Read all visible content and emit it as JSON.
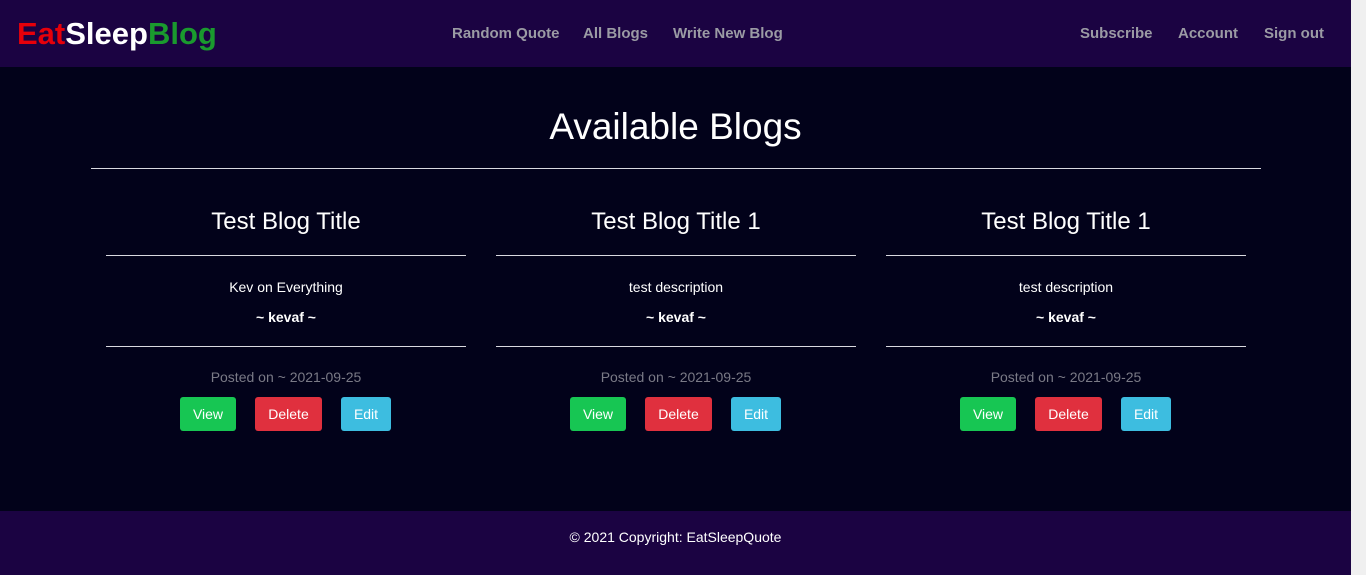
{
  "brand": {
    "part1": "Eat",
    "part2": "Sleep",
    "part3": "Blog"
  },
  "nav": {
    "left": [
      "Random Quote",
      "All Blogs",
      "Write New Blog"
    ],
    "right": [
      "Subscribe",
      "Account",
      "Sign out"
    ]
  },
  "main": {
    "title": "Available Blogs",
    "cards": [
      {
        "title": "Test Blog Title",
        "description": "Kev on Everything",
        "author": "~ kevaf ~",
        "date": "Posted on ~ 2021-09-25",
        "view_label": "View",
        "delete_label": "Delete",
        "edit_label": "Edit"
      },
      {
        "title": "Test Blog Title 1",
        "description": "test description",
        "author": "~ kevaf ~",
        "date": "Posted on ~ 2021-09-25",
        "view_label": "View",
        "delete_label": "Delete",
        "edit_label": "Edit"
      },
      {
        "title": "Test Blog Title 1",
        "description": "test description",
        "author": "~ kevaf ~",
        "date": "Posted on ~ 2021-09-25",
        "view_label": "View",
        "delete_label": "Delete",
        "edit_label": "Edit"
      }
    ]
  },
  "footer": {
    "text": "© 2021 Copyright: EatSleepQuote"
  },
  "colors": {
    "navbar": "#1b0342",
    "background": "#02021a",
    "brand_red": "#e6000a",
    "brand_green": "#1a9a2e",
    "view": "#17c653",
    "delete": "#e0303e",
    "edit": "#3dbde0"
  }
}
